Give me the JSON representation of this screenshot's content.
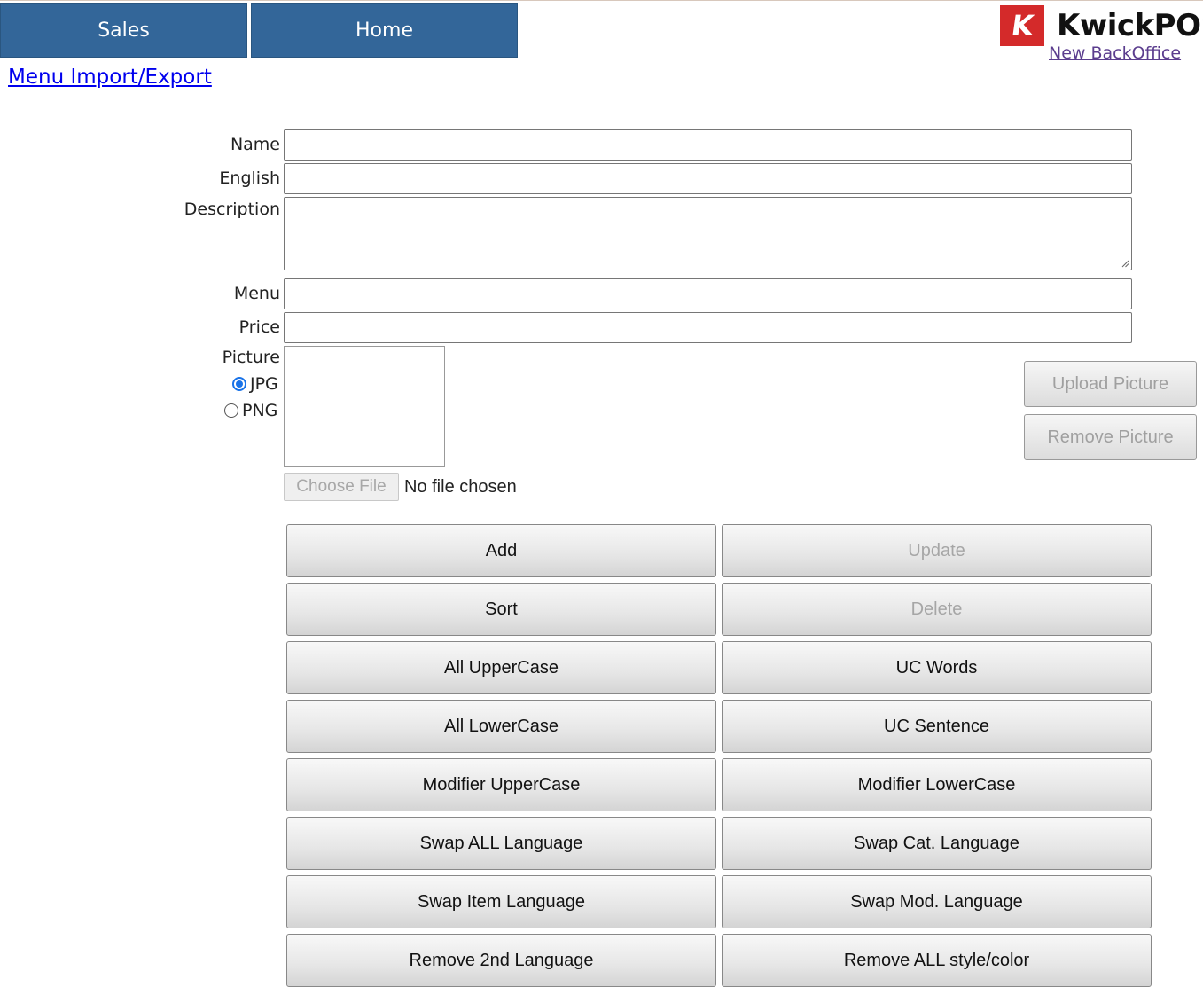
{
  "nav": {
    "sales": "Sales",
    "home": "Home"
  },
  "brand": {
    "logo_letter": "K",
    "logo_text": "KwickPOS",
    "logo_color": "#d42a2a",
    "new_backoffice": "New BackOffice"
  },
  "page_link": "Menu Import/Export",
  "form": {
    "name_label": "Name",
    "english_label": "English",
    "description_label": "Description",
    "menu_label": "Menu",
    "price_label": "Price",
    "picture_label": "Picture",
    "name_value": "",
    "english_value": "",
    "description_value": "",
    "menu_value": "",
    "price_value": "",
    "format_options": [
      {
        "label": "JPG",
        "selected": true
      },
      {
        "label": "PNG",
        "selected": false
      }
    ],
    "choose_file": "Choose File",
    "no_file": "No file chosen",
    "upload_picture": "Upload Picture",
    "remove_picture": "Remove Picture"
  },
  "actions": [
    [
      "Add",
      "Update"
    ],
    [
      "Sort",
      "Delete"
    ],
    [
      "All UpperCase",
      "UC Words"
    ],
    [
      "All LowerCase",
      "UC Sentence"
    ],
    [
      "Modifier UpperCase",
      "Modifier LowerCase"
    ],
    [
      "Swap ALL Language",
      "Swap Cat. Language"
    ],
    [
      "Swap Item Language",
      "Swap Mod. Language"
    ],
    [
      "Remove 2nd Language",
      "Remove ALL style/color"
    ]
  ],
  "colors": {
    "nav_bg": "#336699",
    "link": "#0000ee",
    "disabled_text": "#a6a6a6",
    "radio_accent": "#1a73e8"
  }
}
